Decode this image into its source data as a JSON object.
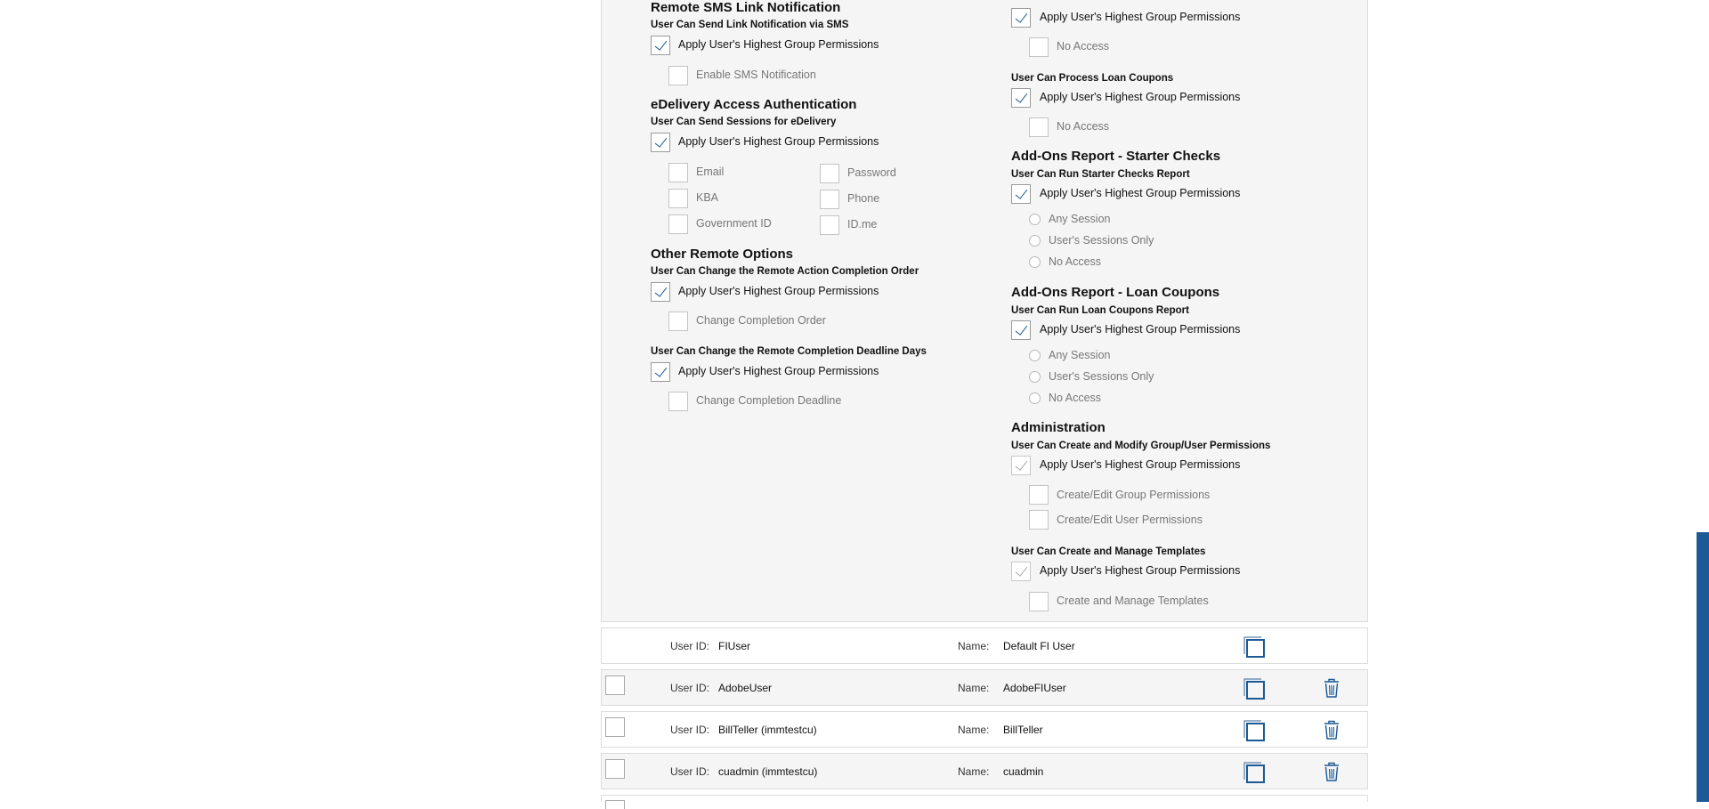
{
  "left_col": {
    "sms": {
      "title": "Remote SMS Link Notification",
      "question": "User Can Send Link Notification via SMS",
      "apply": "Apply User's Highest Group Permissions",
      "option": "Enable SMS Notification"
    },
    "edelivery": {
      "title": "eDelivery Access Authentication",
      "question": "User Can Send Sessions for eDelivery",
      "apply": "Apply User's Highest Group Permissions",
      "opt_email": "Email",
      "opt_password": "Password",
      "opt_kba": "KBA",
      "opt_phone": "Phone",
      "opt_govid": "Government ID",
      "opt_idme": "ID.me"
    },
    "other": {
      "title": "Other Remote Options",
      "q1": "User Can Change the Remote Action Completion Order",
      "apply1": "Apply User's Highest Group Permissions",
      "opt1": "Change Completion Order",
      "q2": "User Can Change the Remote Completion Deadline Days",
      "apply2": "Apply User's Highest Group Permissions",
      "opt2": "Change Completion Deadline"
    }
  },
  "right_col": {
    "starter": {
      "apply": "Apply User's Highest Group Permissions",
      "option": "No Access"
    },
    "loan": {
      "question": "User Can Process Loan Coupons",
      "apply": "Apply User's Highest Group Permissions",
      "option": "No Access"
    },
    "starter_report": {
      "title": "Add-Ons Report - Starter Checks",
      "question": "User Can Run Starter Checks Report",
      "apply": "Apply User's Highest Group Permissions",
      "r1": "Any Session",
      "r2": "User's Sessions Only",
      "r3": "No Access"
    },
    "loan_report": {
      "title": "Add-Ons Report - Loan Coupons",
      "question": "User Can Run Loan Coupons Report",
      "apply": "Apply User's Highest Group Permissions",
      "r1": "Any Session",
      "r2": "User's Sessions Only",
      "r3": "No Access"
    },
    "admin": {
      "title": "Administration",
      "q1": "User Can Create and Modify Group/User Permissions",
      "apply1": "Apply User's Highest Group Permissions",
      "opt1a": "Create/Edit Group Permissions",
      "opt1b": "Create/Edit User Permissions",
      "q2": "User Can Create and Manage Templates",
      "apply2": "Apply User's Highest Group Permissions",
      "opt2": "Create and Manage Templates"
    }
  },
  "users": {
    "userid_label": "User ID:",
    "name_label": "Name:",
    "rows": [
      {
        "user_id": "FIUser",
        "name": "Default FI User"
      },
      {
        "user_id": "AdobeUser",
        "name": "AdobeFIUser"
      },
      {
        "user_id": "BillTeller (immtestcu)",
        "name": "BillTeller"
      },
      {
        "user_id": "cuadmin (immtestcu)",
        "name": "cuadmin"
      }
    ]
  },
  "colors": {
    "accent": "#1c5a96",
    "panel_bg": "#f5f5f5",
    "border": "#dcdcdc"
  }
}
